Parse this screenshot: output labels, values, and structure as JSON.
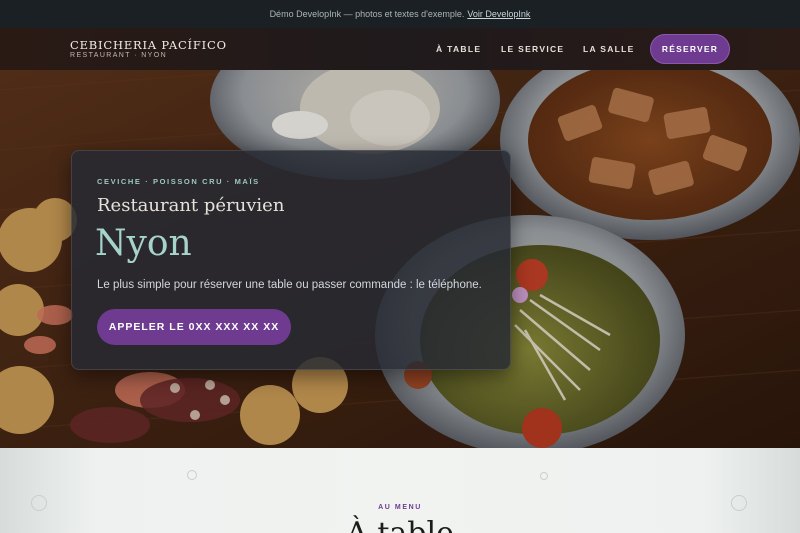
{
  "demo_banner": {
    "text": "Démo DevelopInk — photos et textes d'exemple.",
    "link": "Voir DevelopInk"
  },
  "nav": {
    "brand_name": "CEBICHERIA PACÍFICO",
    "brand_sub": "RESTAURANT · NYON",
    "links": [
      "À TABLE",
      "LE SERVICE",
      "LA SALLE"
    ],
    "reserve_label": "RÉSERVER"
  },
  "hero": {
    "eyebrow": "CEVICHE · POISSON CRU · MAÏS",
    "subtitle": "Restaurant péruvien",
    "city": "Nyon",
    "lead": "Le plus simple pour réserver une table ou passer commande : le téléphone.",
    "call_label": "APPELER LE 0XX XXX XX XX"
  },
  "menu_section": {
    "eyebrow": "AU MENU",
    "title": "À table"
  },
  "colors": {
    "accent": "#6e3b91",
    "teal": "#a6d4cb",
    "banner_bg": "#1a2024"
  }
}
